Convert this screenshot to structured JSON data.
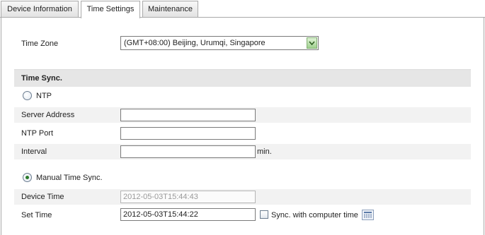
{
  "tabs": [
    {
      "label": "Device Information",
      "active": false
    },
    {
      "label": "Time Settings",
      "active": true
    },
    {
      "label": "Maintenance",
      "active": false
    }
  ],
  "time_zone": {
    "label": "Time Zone",
    "value": "(GMT+08:00) Beijing, Urumqi, Singapore"
  },
  "time_sync": {
    "section_title": "Time Sync.",
    "ntp_option": {
      "label": "NTP",
      "selected": false
    },
    "server_address": {
      "label": "Server Address",
      "value": ""
    },
    "ntp_port": {
      "label": "NTP Port",
      "value": ""
    },
    "interval": {
      "label": "Interval",
      "value": "",
      "unit": "min."
    },
    "manual_option": {
      "label": "Manual Time Sync.",
      "selected": true
    },
    "device_time": {
      "label": "Device Time",
      "value": "2012-05-03T15:44:43"
    },
    "set_time": {
      "label": "Set Time",
      "value": "2012-05-03T15:44:22"
    },
    "sync_computer": {
      "label": "Sync. with computer time",
      "checked": false
    }
  },
  "colors": {
    "section_bg": "#e6e6e6",
    "row_shade": "#f2f2f2",
    "radio_dot": "#2b7a2b",
    "dropdown_arrow": "#9fcf8e"
  }
}
